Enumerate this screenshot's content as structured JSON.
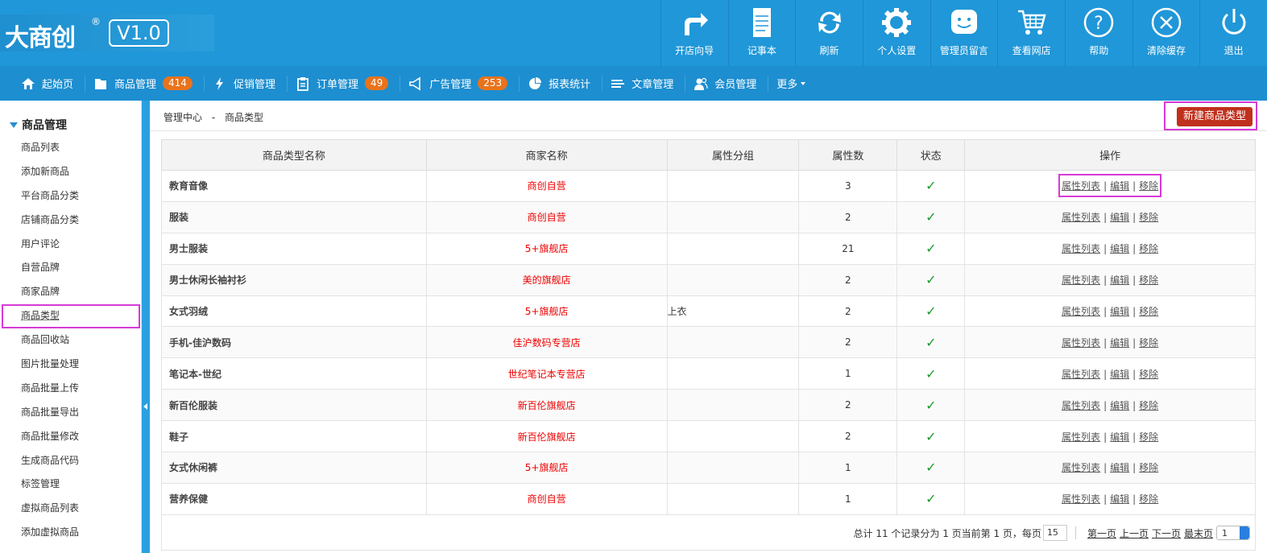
{
  "header": {
    "logo_text": "大商创",
    "logo_reg": "®",
    "version": "V1.0",
    "tools": [
      {
        "label": "开店向导",
        "icon": "share-arrow-icon"
      },
      {
        "label": "记事本",
        "icon": "notepad-icon"
      },
      {
        "label": "刷新",
        "icon": "refresh-icon"
      },
      {
        "label": "个人设置",
        "icon": "gear-icon"
      },
      {
        "label": "管理员留言",
        "icon": "message-icon"
      },
      {
        "label": "查看网店",
        "icon": "cart-icon"
      },
      {
        "label": "帮助",
        "icon": "help-icon"
      },
      {
        "label": "清除缓存",
        "icon": "close-circle-icon"
      },
      {
        "label": "退出",
        "icon": "power-icon"
      }
    ]
  },
  "nav": {
    "items": [
      {
        "label": "起始页",
        "icon": "home-icon"
      },
      {
        "label": "商品管理",
        "icon": "folder-icon",
        "badge": "414"
      },
      {
        "label": "促销管理",
        "icon": "bolt-icon"
      },
      {
        "label": "订单管理",
        "icon": "clipboard-icon",
        "badge": "49"
      },
      {
        "label": "广告管理",
        "icon": "megaphone-icon",
        "badge": "253"
      },
      {
        "label": "报表统计",
        "icon": "pie-chart-icon"
      },
      {
        "label": "文章管理",
        "icon": "list-icon"
      },
      {
        "label": "会员管理",
        "icon": "users-icon"
      }
    ],
    "more_label": "更多"
  },
  "sidebar": {
    "heading": "商品管理",
    "items": [
      "商品列表",
      "添加新商品",
      "平台商品分类",
      "店铺商品分类",
      "用户评论",
      "自营品牌",
      "商家品牌",
      "商品类型",
      "商品回收站",
      "图片批量处理",
      "商品批量上传",
      "商品批量导出",
      "商品批量修改",
      "生成商品代码",
      "标签管理",
      "虚拟商品列表",
      "添加虚拟商品"
    ],
    "active_index": 7
  },
  "breadcrumb": {
    "root": "管理中心",
    "sep": "-",
    "current": "商品类型"
  },
  "new_button_label": "新建商品类型",
  "table": {
    "headers": [
      "商品类型名称",
      "商家名称",
      "属性分组",
      "属性数",
      "状态",
      "操作"
    ],
    "ops": {
      "list": "属性列表",
      "edit": "编辑",
      "remove": "移除",
      "sep": "|"
    },
    "status_mark": "✓",
    "rows": [
      {
        "name": "教育音像",
        "shop": "商创自营",
        "group": "",
        "count": "3"
      },
      {
        "name": "服装",
        "shop": "商创自营",
        "group": "",
        "count": "2"
      },
      {
        "name": "男士服装",
        "shop": "5+旗舰店",
        "group": "",
        "count": "21"
      },
      {
        "name": "男士休闲长袖衬衫",
        "shop": "美的旗舰店",
        "group": "",
        "count": "2"
      },
      {
        "name": "女式羽绒",
        "shop": "5+旗舰店",
        "group": "上衣",
        "count": "2"
      },
      {
        "name": "手机-佳沪数码",
        "shop": "佳沪数码专营店",
        "group": "",
        "count": "2"
      },
      {
        "name": "笔记本-世纪",
        "shop": "世纪笔记本专营店",
        "group": "",
        "count": "1"
      },
      {
        "name": "新百伦服装",
        "shop": "新百伦旗舰店",
        "group": "",
        "count": "2"
      },
      {
        "name": "鞋子",
        "shop": "新百伦旗舰店",
        "group": "",
        "count": "2"
      },
      {
        "name": "女式休闲裤",
        "shop": "5+旗舰店",
        "group": "",
        "count": "1"
      },
      {
        "name": "营养保健",
        "shop": "商创自营",
        "group": "",
        "count": "1"
      }
    ]
  },
  "pager": {
    "summary": "总计 11 个记录分为 1 页当前第 1 页，每页",
    "per_page": "15",
    "first": "第一页",
    "prev": "上一页",
    "next": "下一页",
    "last": "最末页",
    "page_select": "1"
  }
}
